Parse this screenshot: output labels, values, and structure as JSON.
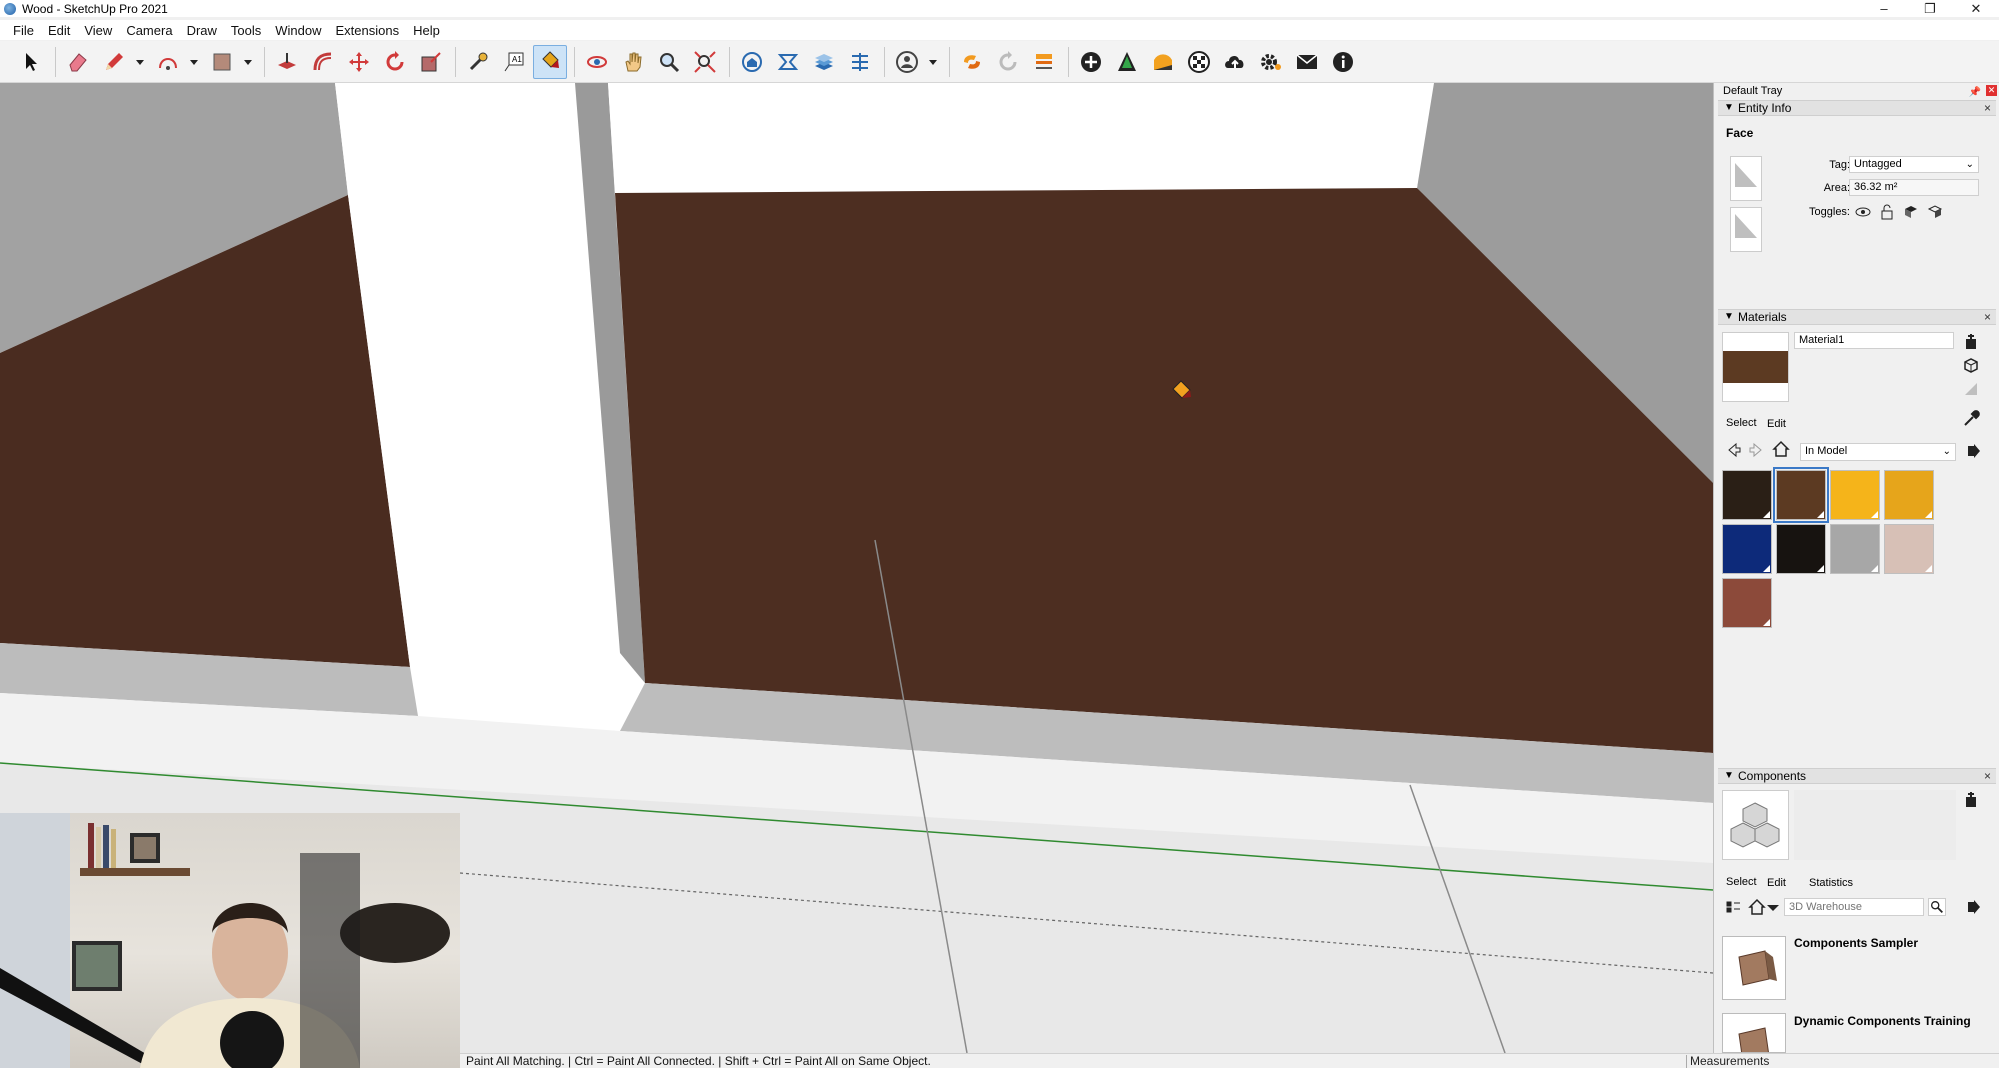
{
  "window": {
    "title": "Wood - SketchUp Pro 2021",
    "controls": [
      "–",
      "❐",
      "✕"
    ]
  },
  "menu": [
    "File",
    "Edit",
    "View",
    "Camera",
    "Draw",
    "Tools",
    "Window",
    "Extensions",
    "Help"
  ],
  "toolbar": {
    "tools": [
      "select-icon",
      "eraser-icon",
      "pencil-icon",
      "dropdown",
      "arc-icon",
      "dropdown",
      "rectangle-icon",
      "dropdown",
      "push-pull-icon",
      "offset-icon",
      "move-icon",
      "rotate-icon",
      "scale-icon",
      "tape-measure-icon",
      "text-icon",
      "paint-bucket-icon",
      "orbit-icon",
      "pan-icon",
      "zoom-icon",
      "zoom-extents-icon",
      "warehouse-icon",
      "extension-warehouse-icon",
      "layout-icon",
      "send-icon",
      "user-icon",
      "dropdown",
      "solid-tools-icon",
      "sync-icon",
      "section-icon",
      "add-location-icon",
      "tree-icon",
      "shadows-icon",
      "checker-icon",
      "cloud-upload-icon",
      "gear-icon",
      "mail-icon",
      "info-icon"
    ],
    "active_tool": "paint-bucket-icon"
  },
  "status": {
    "hint": "Paint All Matching. | Ctrl = Paint All Connected. | Shift + Ctrl = Paint All on Same Object.",
    "measurements_label": "Measurements"
  },
  "tray": {
    "title": "Default Tray",
    "entity_info": {
      "header": "Entity Info",
      "type": "Face",
      "tag_label": "Tag:",
      "tag_value": "Untagged",
      "area_label": "Area:",
      "area_value": "36.32 m²",
      "toggles_label": "Toggles:"
    },
    "materials": {
      "header": "Materials",
      "name": "Material1",
      "current_color": "#5c3a22",
      "tabs": [
        "Select",
        "Edit"
      ],
      "library": "In Model",
      "swatches": [
        "#2a1f16",
        "#5c3a22",
        "#f5b41a",
        "#e6a51b",
        "#0d2a7a",
        "#171310",
        "#a7a7a7",
        "#d7c0b6",
        "#8c4a3a"
      ],
      "selected_index": 1
    },
    "components": {
      "header": "Components",
      "tabs": [
        "Select",
        "Edit",
        "Statistics"
      ],
      "search_placeholder": "3D Warehouse",
      "items": [
        {
          "title": "Components Sampler"
        },
        {
          "title": "Dynamic Components Training"
        }
      ]
    }
  }
}
